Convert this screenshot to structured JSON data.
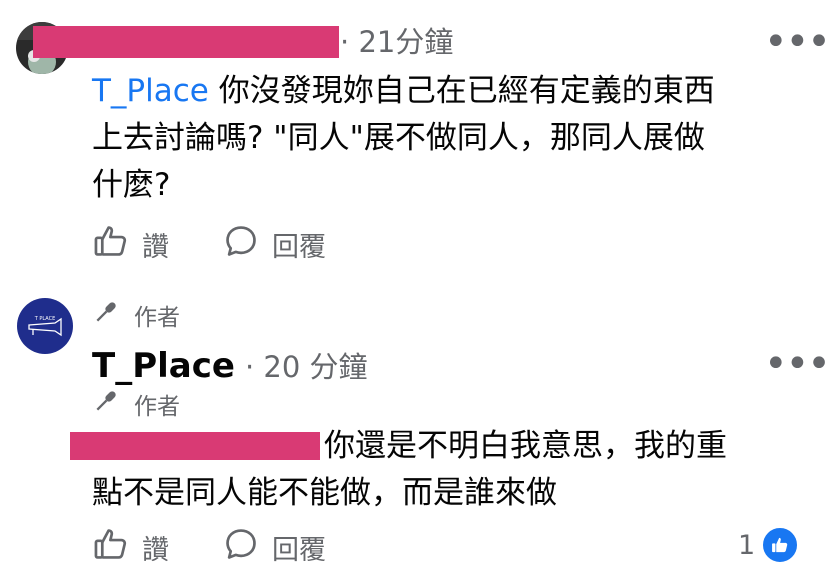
{
  "comment1": {
    "time": "21分鐘",
    "mention": "T_Place",
    "text_line1": " 你沒發現妳自己在已經有定義的東西",
    "text_line2": "上去討論嗎? \"同人\"展不做同人，那同人展做",
    "text_line3": "什麼?",
    "like_label": "讚",
    "reply_label": "回覆"
  },
  "comment2": {
    "author_badge": "作者",
    "name": "T_Place",
    "time": "20 分鐘",
    "author_badge_2": "作者",
    "text_line1": "你還是不明白我意思，我的重",
    "text_line2": "點不是同人能不能做，而是誰來做",
    "like_label": "讚",
    "reply_label": "回覆",
    "reaction_count": "1"
  },
  "colors": {
    "redaction": "#d93a74",
    "mention": "#1877f2",
    "muted": "#65676b",
    "avatar_brand": "#1f2d8c"
  }
}
